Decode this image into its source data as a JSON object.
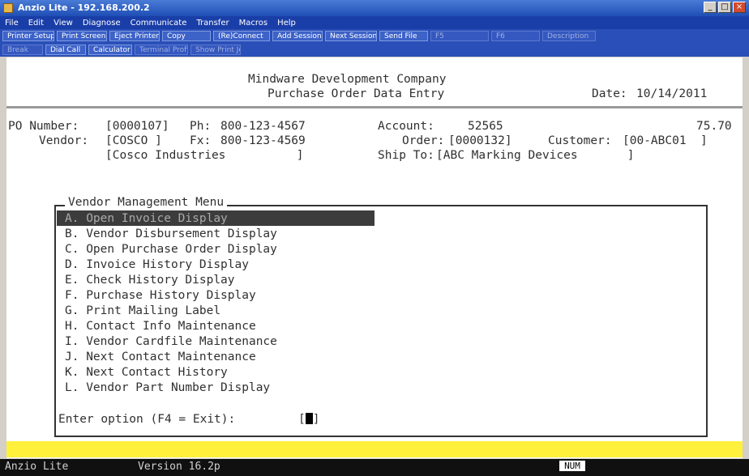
{
  "window": {
    "title": "Anzio Lite - 192.168.200.2",
    "buttons": [
      "_",
      "□",
      "×"
    ]
  },
  "menubar": [
    "File",
    "Edit",
    "View",
    "Diagnose",
    "Communicate",
    "Transfer",
    "Macros",
    "Help"
  ],
  "toolbar1": [
    "Printer Setup",
    "Print Screen",
    "Eject Printer",
    "Copy",
    "(Re)Connect",
    "Add Session",
    "Next Session",
    "Send File",
    "F5",
    "F6",
    "Description"
  ],
  "toolbar2": [
    "Break",
    "Dial Call",
    "Calculator",
    "Terminal Profile",
    "Show Print Job"
  ],
  "header": {
    "company": "Mindware Development Company",
    "screen_title": "Purchase Order Data Entry",
    "date_label": "Date:",
    "date": "10/14/2011"
  },
  "po": {
    "po_label": "PO Number:",
    "po_number": "[0000107]",
    "ph_label": "Ph:",
    "phone": "800-123-4567",
    "account_label": "Account:",
    "account": "52565",
    "amount": "75.70",
    "vendor_label": "Vendor:",
    "vendor": "[COSCO ]",
    "fx_label": "Fx:",
    "fax": "800-123-4569",
    "order_label": "Order:",
    "order": "[0000132]",
    "customer_label": "Customer:",
    "customer": "[00-ABC01  ]",
    "vendor_name": "[Cosco Industries          ]",
    "shipto_label": "Ship To:",
    "shipto": "[ABC Marking Devices       ]"
  },
  "menu": {
    "title": "Vendor Management Menu",
    "items": [
      "A. Open Invoice Display",
      "B. Vendor Disbursement Display",
      "C. Open Purchase Order Display",
      "D. Invoice History Display",
      "E. Check History Display",
      "F. Purchase History Display",
      "G. Print Mailing Label",
      "H. Contact Info Maintenance",
      "I. Vendor Cardfile Maintenance",
      "J. Next Contact Maintenance",
      "K. Next Contact History",
      "L. Vendor Part Number Display"
    ],
    "prompt": "Enter option (F4 = Exit):",
    "field_open": "[",
    "field_close": "]"
  },
  "status": {
    "product": "Anzio Lite",
    "version": "Version 16.2p",
    "num": "NUM"
  }
}
